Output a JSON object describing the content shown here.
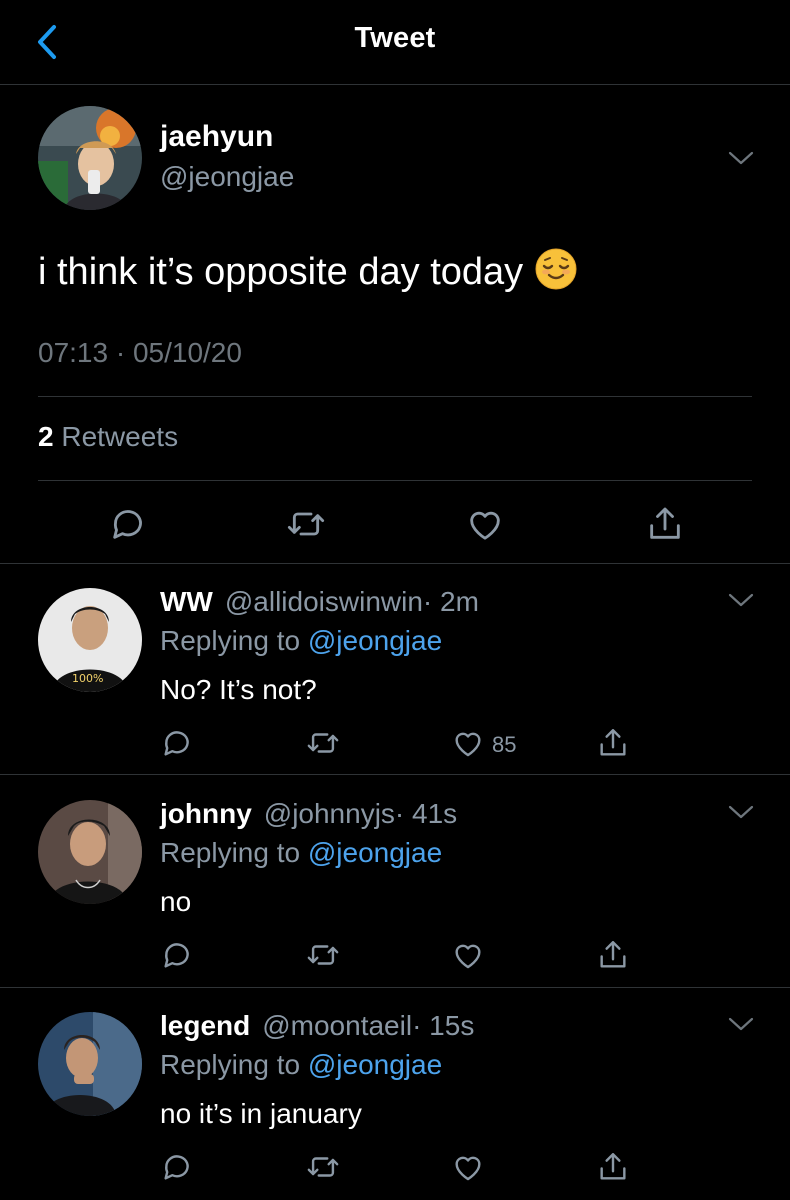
{
  "header": {
    "title": "Tweet"
  },
  "tweet": {
    "name": "jaehyun",
    "handle": "@jeongjae",
    "text": "i think it’s opposite day today",
    "emoji": "relieved-face-emoji",
    "timestamp": "07:13 · 05/10/20",
    "retweet_count": "2",
    "retweet_label": "Retweets"
  },
  "replies": [
    {
      "name": "WW",
      "handle": "@allidoiswinwin",
      "time": "· 2m",
      "replying_prefix": "Replying to",
      "replying_to": "@jeongjae",
      "text": "No? It’s not?",
      "likes": "85"
    },
    {
      "name": "johnny",
      "handle": "@johnnyjs",
      "time": "· 41s",
      "replying_prefix": "Replying to",
      "replying_to": "@jeongjae",
      "text": "no",
      "likes": ""
    },
    {
      "name": "legend",
      "handle": "@moontaeil",
      "time": "· 15s",
      "replying_prefix": "Replying to",
      "replying_to": "@jeongjae",
      "text": "no it’s in january",
      "likes": ""
    }
  ],
  "colors": {
    "background": "#000000",
    "accent": "#4da3ec",
    "muted": "#8b98a5",
    "divider": "#2f3336"
  },
  "icons": [
    "back-chevron-icon",
    "chevron-down-icon",
    "reply-icon",
    "retweet-icon",
    "like-icon",
    "share-icon"
  ]
}
